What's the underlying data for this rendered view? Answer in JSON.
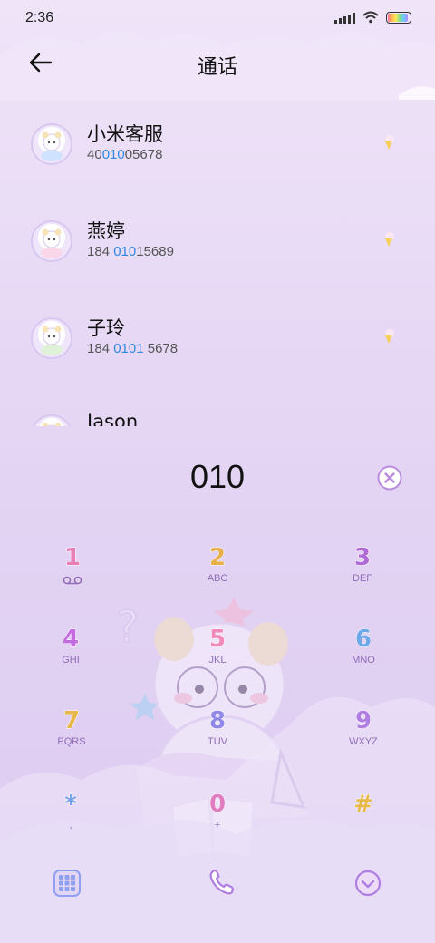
{
  "status": {
    "time": "2:36"
  },
  "header": {
    "title": "通话"
  },
  "contacts": [
    {
      "name": "小米客服",
      "num_a": "40",
      "num_hl": "010",
      "num_b": "05678"
    },
    {
      "name": "燕婷",
      "num_a": "184 ",
      "num_hl": "010",
      "num_b": "15689"
    },
    {
      "name": "子玲",
      "num_a": "184 ",
      "num_hl": "0101",
      "num_b": " 5678"
    },
    {
      "name": "Jason",
      "num_a": "",
      "num_hl": "",
      "num_b": ""
    }
  ],
  "dialer": {
    "input": "010"
  },
  "keypad": [
    {
      "digit": "1",
      "letters": "",
      "color": "#e87fb5"
    },
    {
      "digit": "2",
      "letters": "ABC",
      "color": "#e8b04a"
    },
    {
      "digit": "3",
      "letters": "DEF",
      "color": "#b06ad8"
    },
    {
      "digit": "4",
      "letters": "GHI",
      "color": "#c46be0"
    },
    {
      "digit": "5",
      "letters": "JKL",
      "color": "#f08ab8"
    },
    {
      "digit": "6",
      "letters": "MNO",
      "color": "#6fa8e8"
    },
    {
      "digit": "7",
      "letters": "PQRS",
      "color": "#e9b84a"
    },
    {
      "digit": "8",
      "letters": "TUV",
      "color": "#8f88e8"
    },
    {
      "digit": "9",
      "letters": "WXYZ",
      "color": "#b07ee0"
    },
    {
      "digit": "*",
      "letters": ",",
      "color": "#7aa0e8"
    },
    {
      "digit": "0",
      "letters": "+",
      "color": "#e07cc0"
    },
    {
      "digit": "#",
      "letters": "",
      "color": "#e9b84a"
    }
  ],
  "colors": {
    "accent": "#b98bdc",
    "highlight": "#2f87e0",
    "background": "#e3d3f3"
  },
  "icons": {
    "back": "arrow-left-icon",
    "clear": "clear-icon",
    "grid": "dialpad-grid-icon",
    "call": "phone-icon",
    "collapse": "chevron-down-icon"
  }
}
